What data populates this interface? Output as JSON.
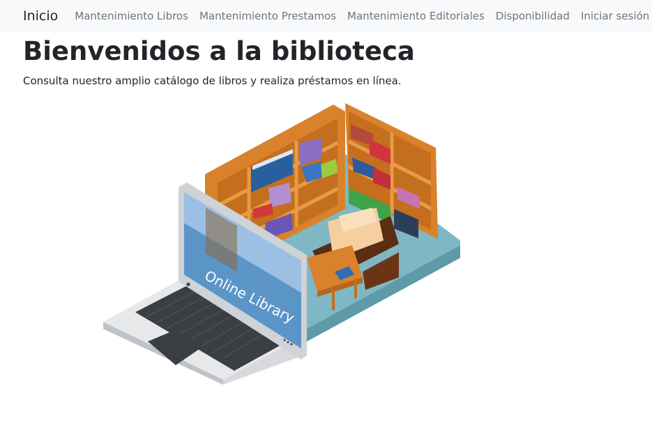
{
  "navbar": {
    "brand": "Inicio",
    "links": [
      "Mantenimiento Libros",
      "Mantenimiento Prestamos",
      "Mantenimiento Editoriales",
      "Disponibilidad",
      "Iniciar sesión"
    ]
  },
  "main": {
    "title": "Bienvenidos a la biblioteca",
    "subtitle": "Consulta nuestro amplio catálogo de libros y realiza préstamos en línea."
  },
  "hero": {
    "screen_text": "Online Library"
  }
}
